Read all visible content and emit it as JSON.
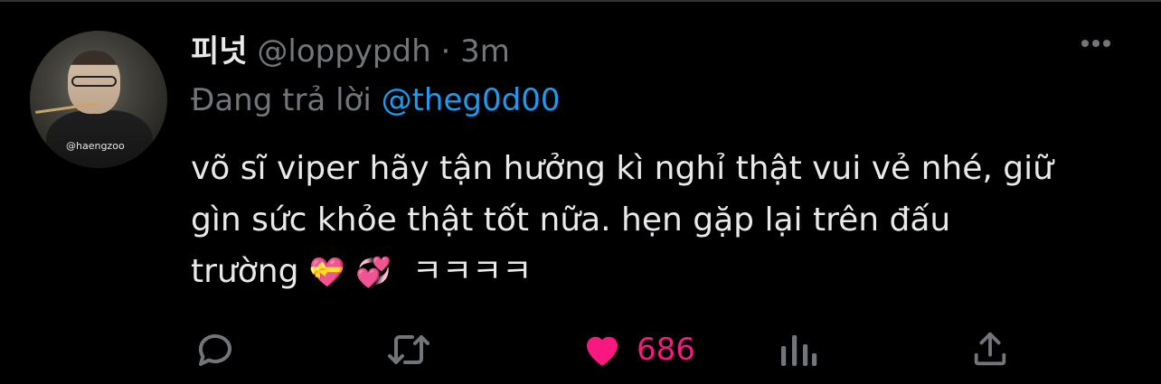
{
  "tweet": {
    "author": {
      "display_name": "피넛",
      "handle": "@loppypdh",
      "separator": "·",
      "time": "3m",
      "avatar_watermark": "@haengzoo"
    },
    "reply": {
      "prefix": "Đang trả lời",
      "mention": "@theg0d00"
    },
    "body_lines": [
      "võ sĩ viper hãy tận hưởng kì nghỉ thật vui vẻ nhé, giữ",
      "gìn sức khỏe thật tốt nữa. hẹn gặp lại trên đấu",
      "trường"
    ],
    "emoji_1": "💝",
    "emoji_2": "💞",
    "body_suffix": "ㅋㅋㅋㅋ",
    "actions": {
      "like_count": "686"
    },
    "icons": {
      "more": "more-icon",
      "reply": "reply-icon",
      "retweet": "retweet-icon",
      "like": "heart-icon",
      "views": "views-icon",
      "share": "share-icon"
    },
    "colors": {
      "background": "#000000",
      "text": "#e7e9ea",
      "muted": "#71767b",
      "link": "#1d9bf0",
      "like": "#f91880"
    }
  }
}
